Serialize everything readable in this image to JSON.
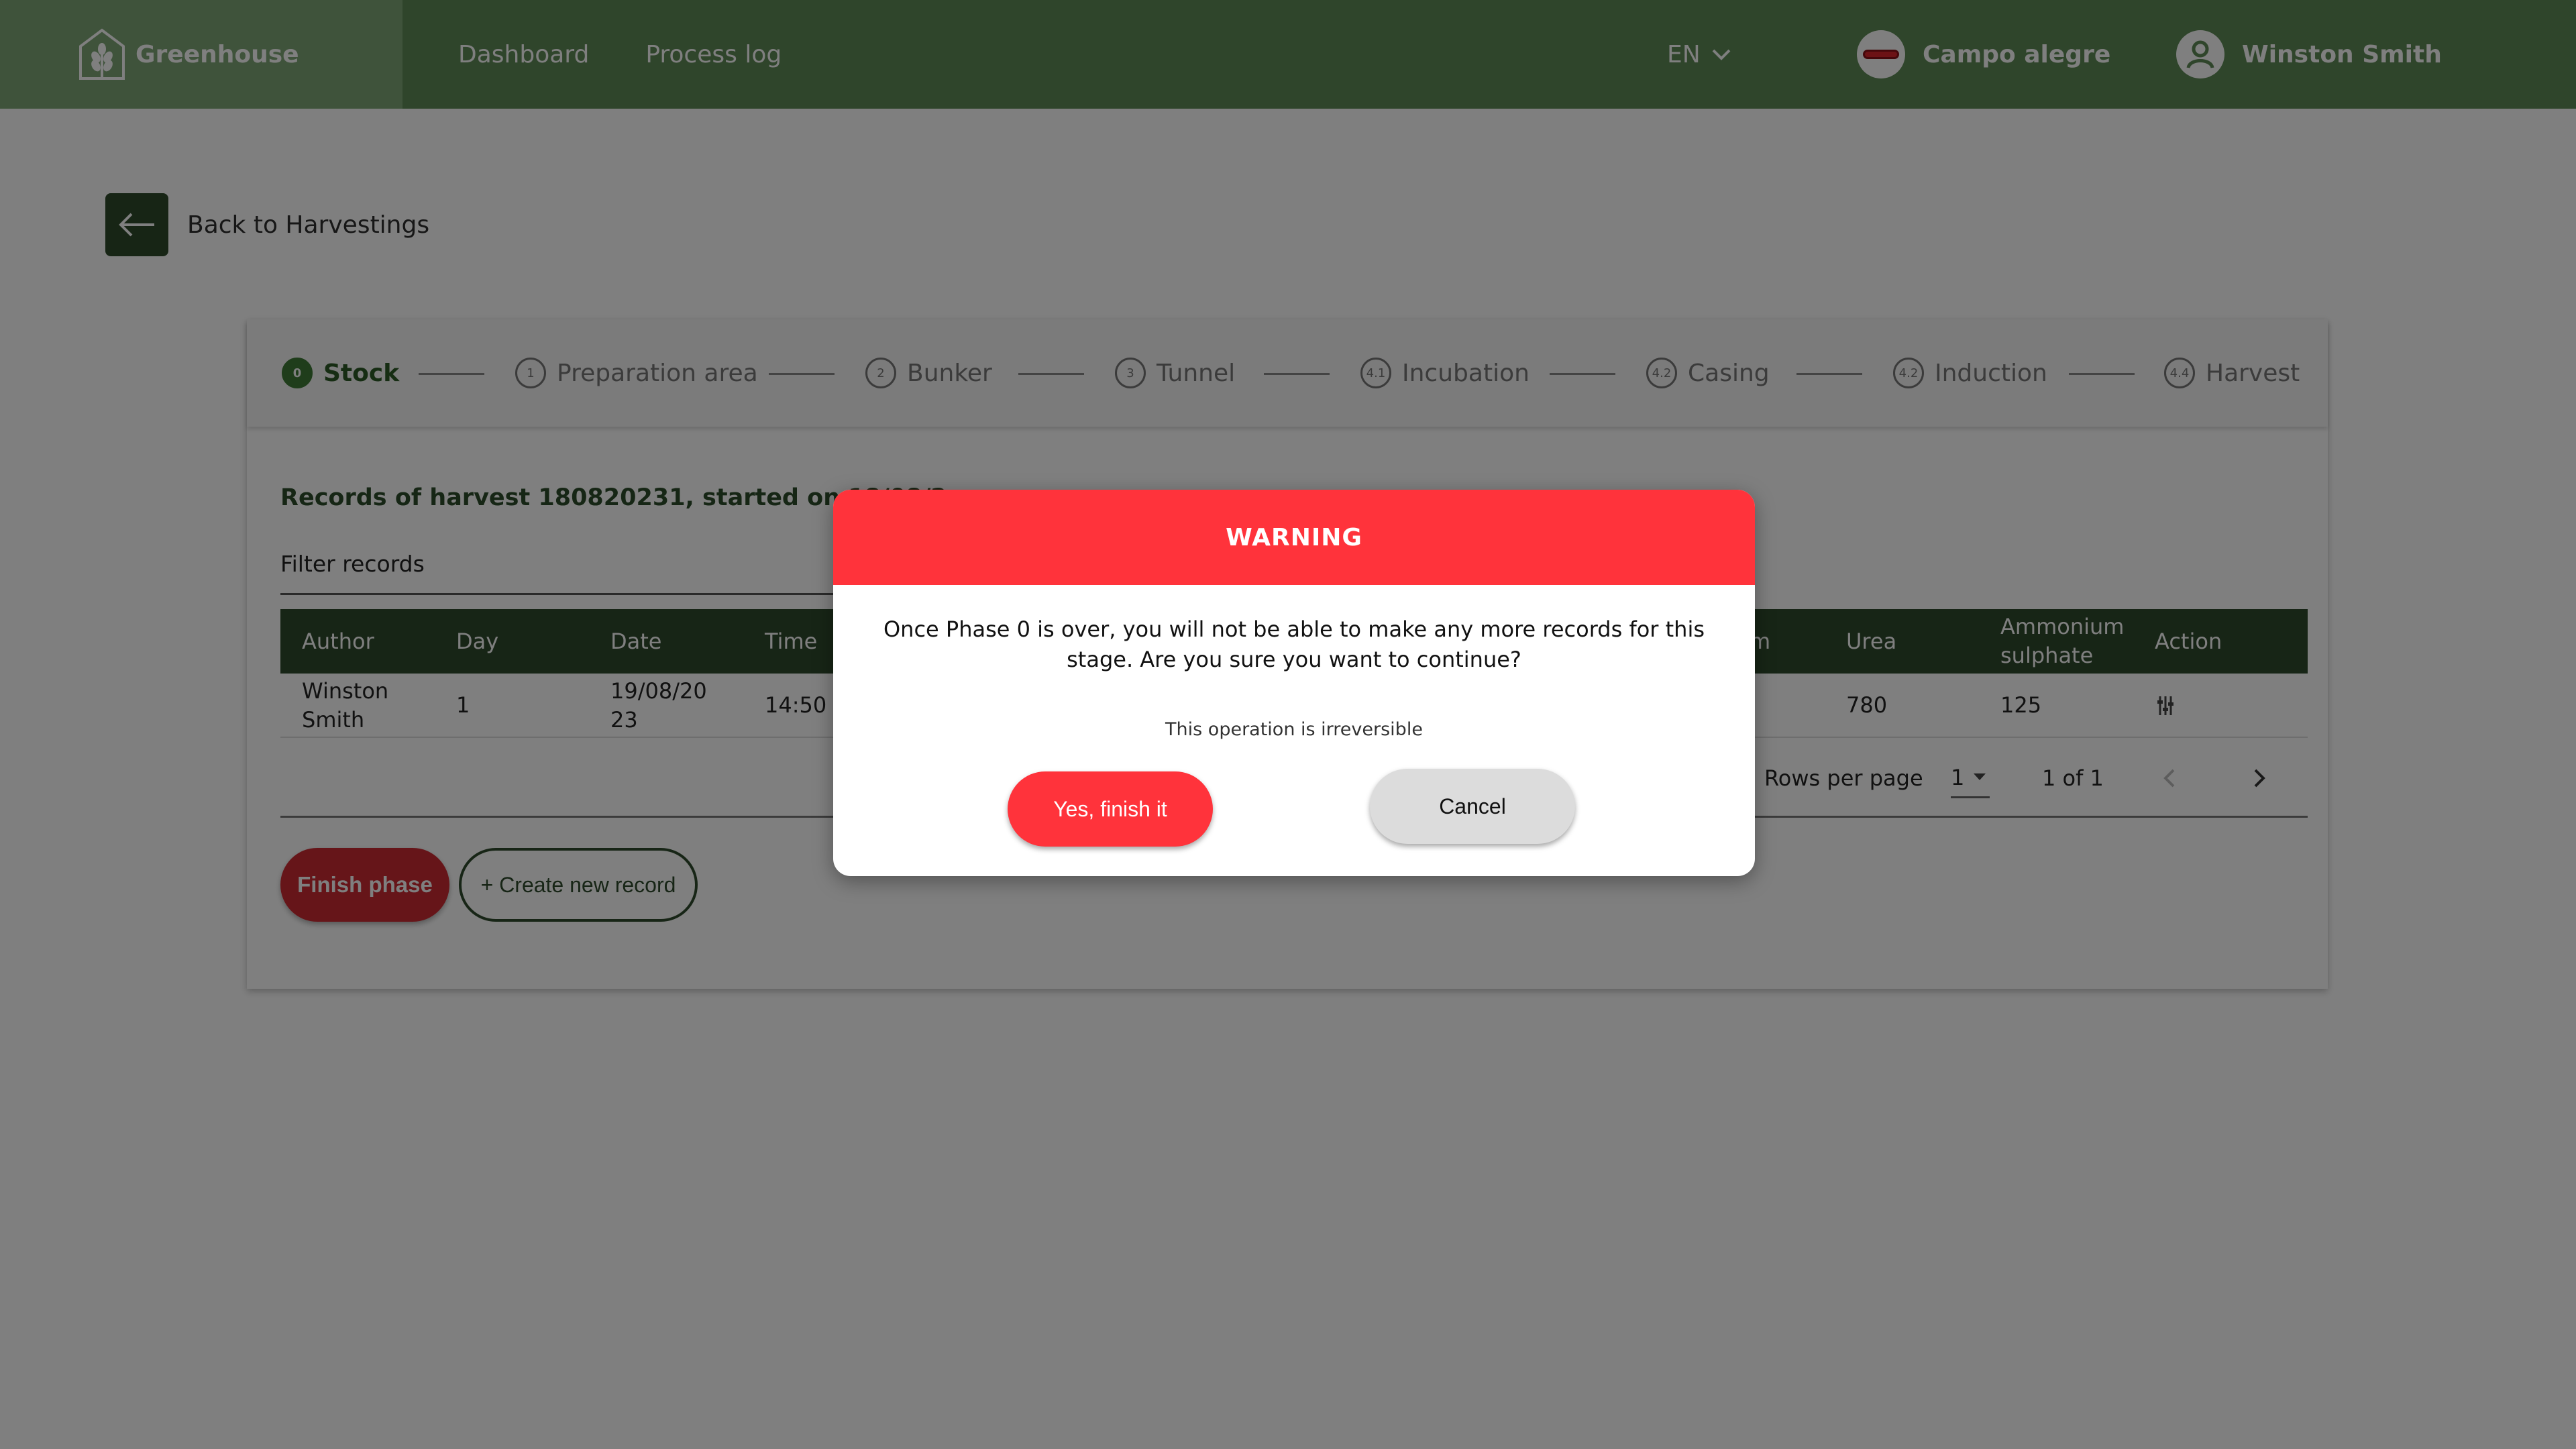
{
  "header": {
    "brand": "Greenhouse",
    "nav": [
      "Dashboard",
      "Process log"
    ],
    "language": "EN",
    "company": "Campo alegre",
    "user": "Winston Smith"
  },
  "back": {
    "label": "Back to Harvestings"
  },
  "steps": [
    {
      "num": "0",
      "label": "Stock",
      "active": true
    },
    {
      "num": "1",
      "label": "Preparation area"
    },
    {
      "num": "2",
      "label": "Bunker"
    },
    {
      "num": "3",
      "label": "Tunnel"
    },
    {
      "num": "4.1",
      "label": "Incubation"
    },
    {
      "num": "4.2",
      "label": "Casing"
    },
    {
      "num": "4.2",
      "label": "Induction"
    },
    {
      "num": "4.4",
      "label": "Harvest"
    }
  ],
  "records": {
    "title": "Records of harvest 180820231, started on 18/08/2",
    "filter_label": "Filter records"
  },
  "table": {
    "headers": {
      "author": "Author",
      "day": "Day",
      "date": "Date",
      "time": "Time",
      "partial": "m",
      "urea": "Urea",
      "ammonium": "Ammonium sulphate",
      "action": "Action"
    },
    "row": {
      "author": "Winston Smith",
      "day": "1",
      "date": "19/08/2023",
      "time": "14:50",
      "urea": "780",
      "ammonium": "125"
    },
    "pagination": {
      "rows_label": "Rows per page",
      "rows_value": "1",
      "range": "1 of 1"
    }
  },
  "buttons": {
    "finish": "Finish phase",
    "create": "+ Create new record"
  },
  "modal": {
    "title": "WARNING",
    "message": "Once Phase 0 is over, you will not be able to make any more records for this stage. Are you sure you want to continue?",
    "note": "This operation is irreversible",
    "confirm": "Yes, finish it",
    "cancel": "Cancel"
  }
}
